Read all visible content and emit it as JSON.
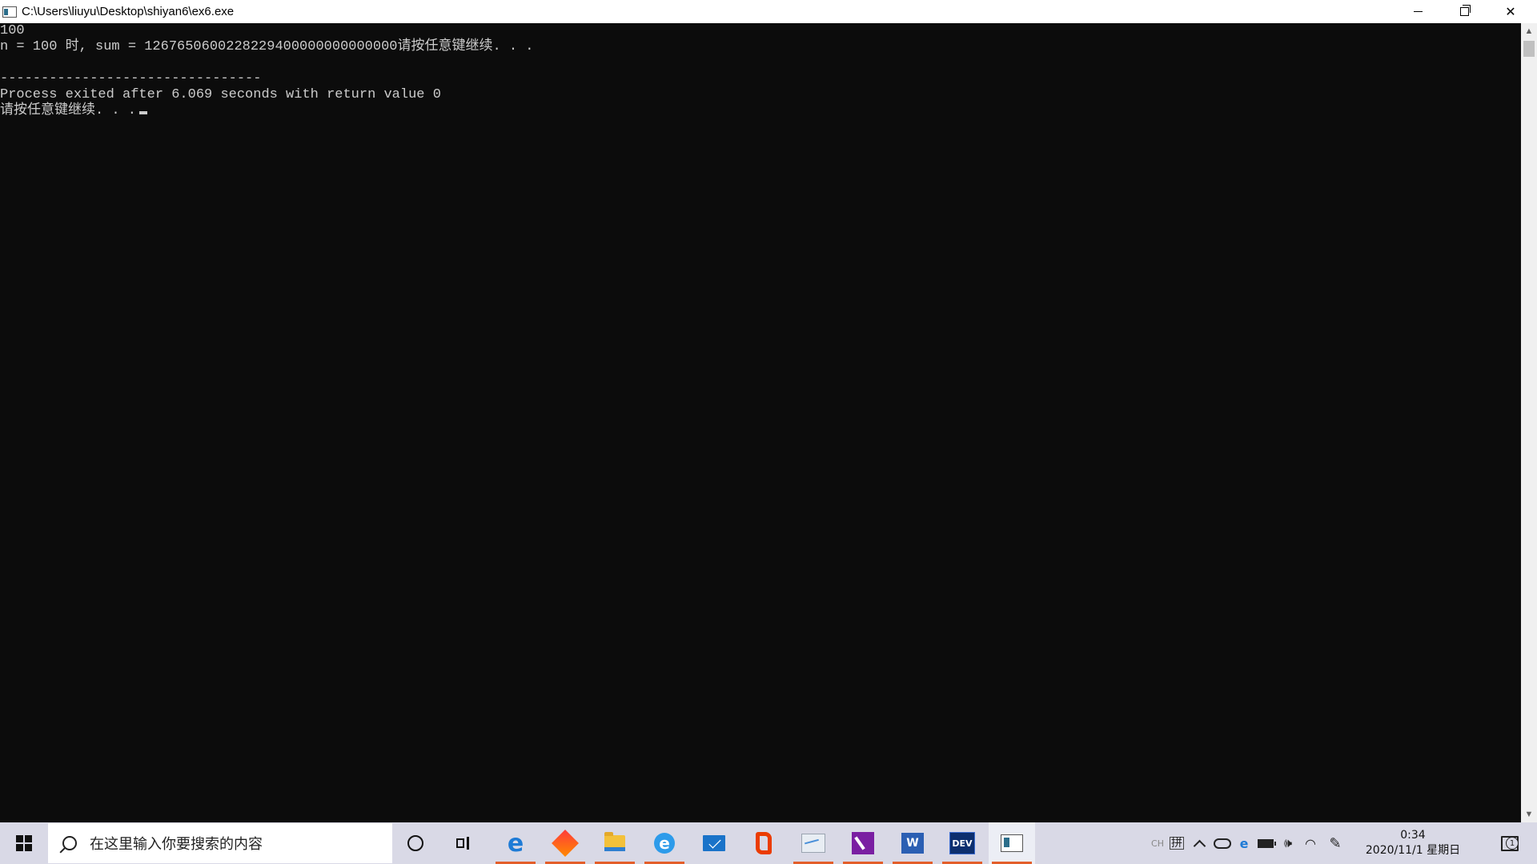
{
  "window": {
    "title": "C:\\Users\\liuyu\\Desktop\\shiyan6\\ex6.exe",
    "icon": "console-app-icon",
    "controls": [
      "minimize-icon",
      "restore-icon",
      "close-icon"
    ]
  },
  "console": {
    "lines": [
      "100",
      "n = 100 时, sum = 1267650600228229400000000000000请按任意键继续. . .",
      "",
      "--------------------------------",
      "Process exited after 6.069 seconds with return value 0",
      "请按任意键继续. . ."
    ],
    "foreground": "#cccccc",
    "background": "#0c0c0c"
  },
  "taskbar": {
    "search_placeholder": "在这里输入你要搜索的内容",
    "apps": [
      {
        "name": "edge-icon",
        "label": "e"
      },
      {
        "name": "rdm-icon"
      },
      {
        "name": "file-explorer-icon"
      },
      {
        "name": "ie-icon",
        "label": "e"
      },
      {
        "name": "mail-icon"
      },
      {
        "name": "office-icon"
      },
      {
        "name": "paint-icon"
      },
      {
        "name": "onenote-icon"
      },
      {
        "name": "word-icon",
        "label": "W"
      },
      {
        "name": "devcpp-icon",
        "label": "DEV"
      },
      {
        "name": "console-window-icon"
      }
    ],
    "accent": "#e35e2a"
  },
  "tray": {
    "ime_ch": "CH",
    "ime_mode": "拼",
    "edge_symbol": "e",
    "volume_symbol": "🕪",
    "wifi_symbol": "◠",
    "pen_symbol": "✎",
    "time": "0:34",
    "date": "2020/11/1 星期日",
    "notification_count": "1"
  }
}
